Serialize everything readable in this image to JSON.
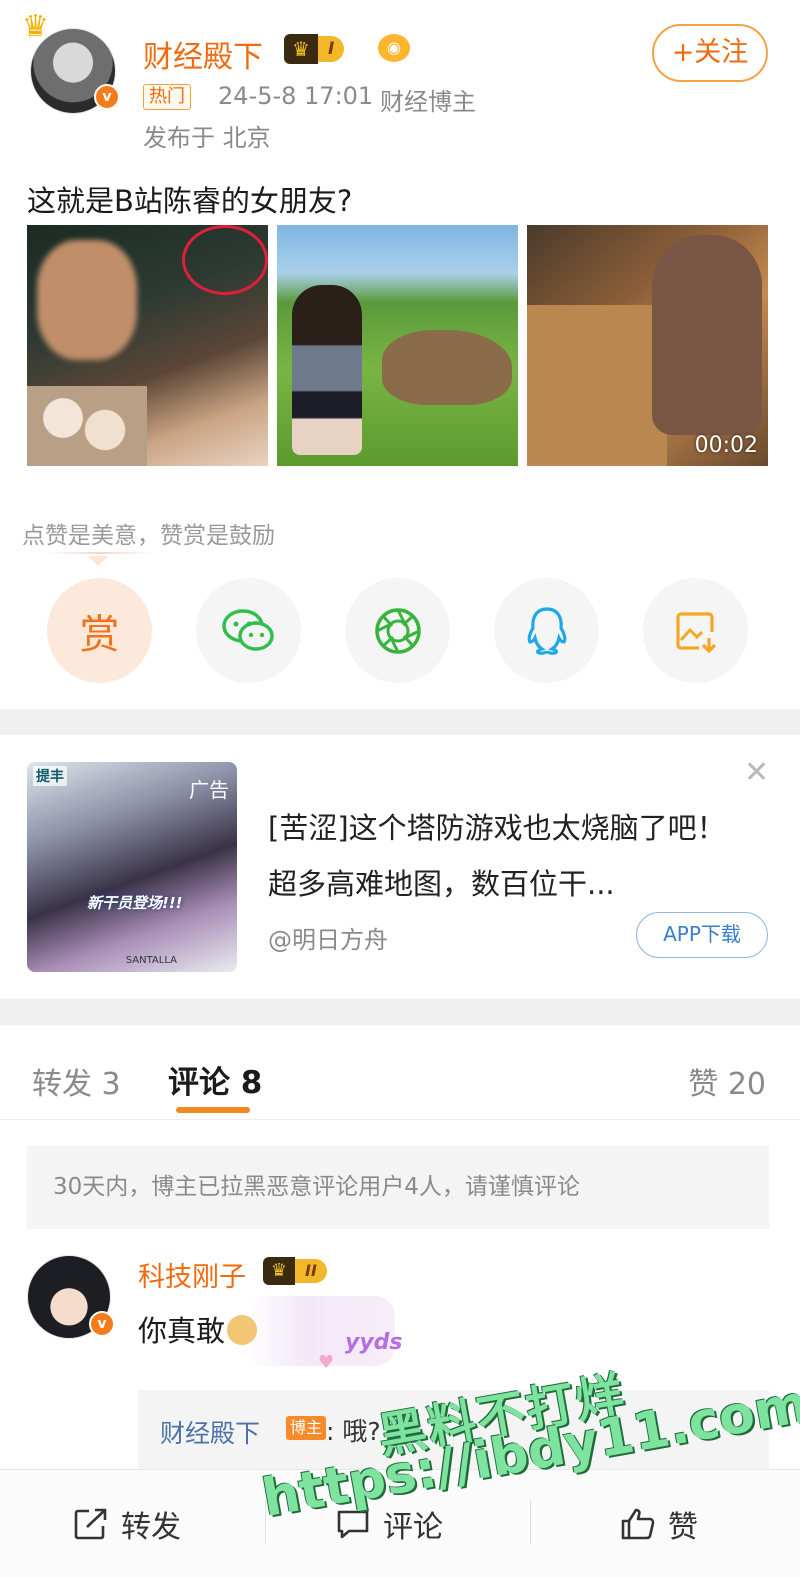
{
  "post": {
    "author": "财经殿下",
    "level": "I",
    "follow_label": "+关注",
    "hot_tag": "热门",
    "time": "24-5-8 17:01",
    "role": "财经博主",
    "location": "发布于 北京",
    "text": "这就是B站陈睿的女朋友?",
    "video_duration": "00:02"
  },
  "reward": {
    "hint": "点赞是美意，赞赏是鼓励",
    "reward_label": "赏"
  },
  "ad": {
    "tag": "广告",
    "logo": "提丰",
    "banner": "新干员登场!!!",
    "brand": "SANTALLA",
    "title": "[苦涩]这个塔防游戏也太烧脑了吧！ 超多高难地图，数百位干...",
    "source": "@明日方舟",
    "download_label": "APP下载"
  },
  "tabs": {
    "forward": "转发 3",
    "comment": "评论 8",
    "like": "赞 20"
  },
  "notice": "30天内，博主已拉黑恶意评论用户4人，请谨慎评论",
  "comment": {
    "author": "科技刚子",
    "level": "II",
    "text": "你真敢",
    "sticker": "yyds",
    "reply": {
      "author": "财经殿下",
      "tag": "博主",
      "text": ": 哦?"
    }
  },
  "bottom_bar": {
    "forward": "转发",
    "comment": "评论",
    "like": "赞"
  },
  "watermark": {
    "line1": "黑料不打烊",
    "line2": "https://ibdy11.com"
  },
  "colors": {
    "accent_orange": "#f06a0e",
    "link_blue": "#4b72a8",
    "watermark_green": "#7fe3a0"
  }
}
